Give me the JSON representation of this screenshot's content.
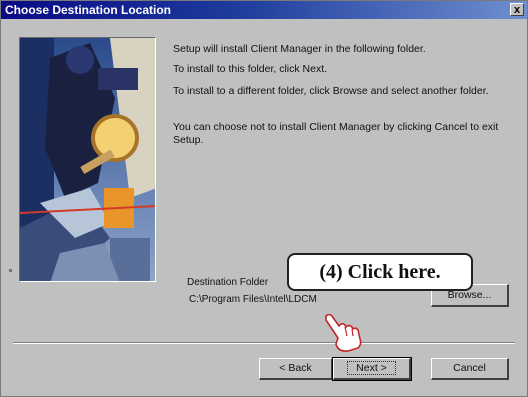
{
  "window": {
    "title": "Choose Destination Location",
    "close_label": "x"
  },
  "body": {
    "p1": "Setup will install Client Manager in the following folder.",
    "p2": "To install to this folder, click Next.",
    "p3": "To install to a different folder, click Browse and select another folder.",
    "p4": "You can choose not to install Client Manager by clicking Cancel to exit Setup."
  },
  "destination": {
    "label": "Destination Folder",
    "path": "C:\\Program Files\\Intel\\LDCM",
    "browse_label": "Browse..."
  },
  "footer": {
    "back_label": "< Back",
    "next_label": "Next >",
    "cancel_label": "Cancel"
  },
  "annotation": {
    "callout": "(4)  Click here."
  }
}
